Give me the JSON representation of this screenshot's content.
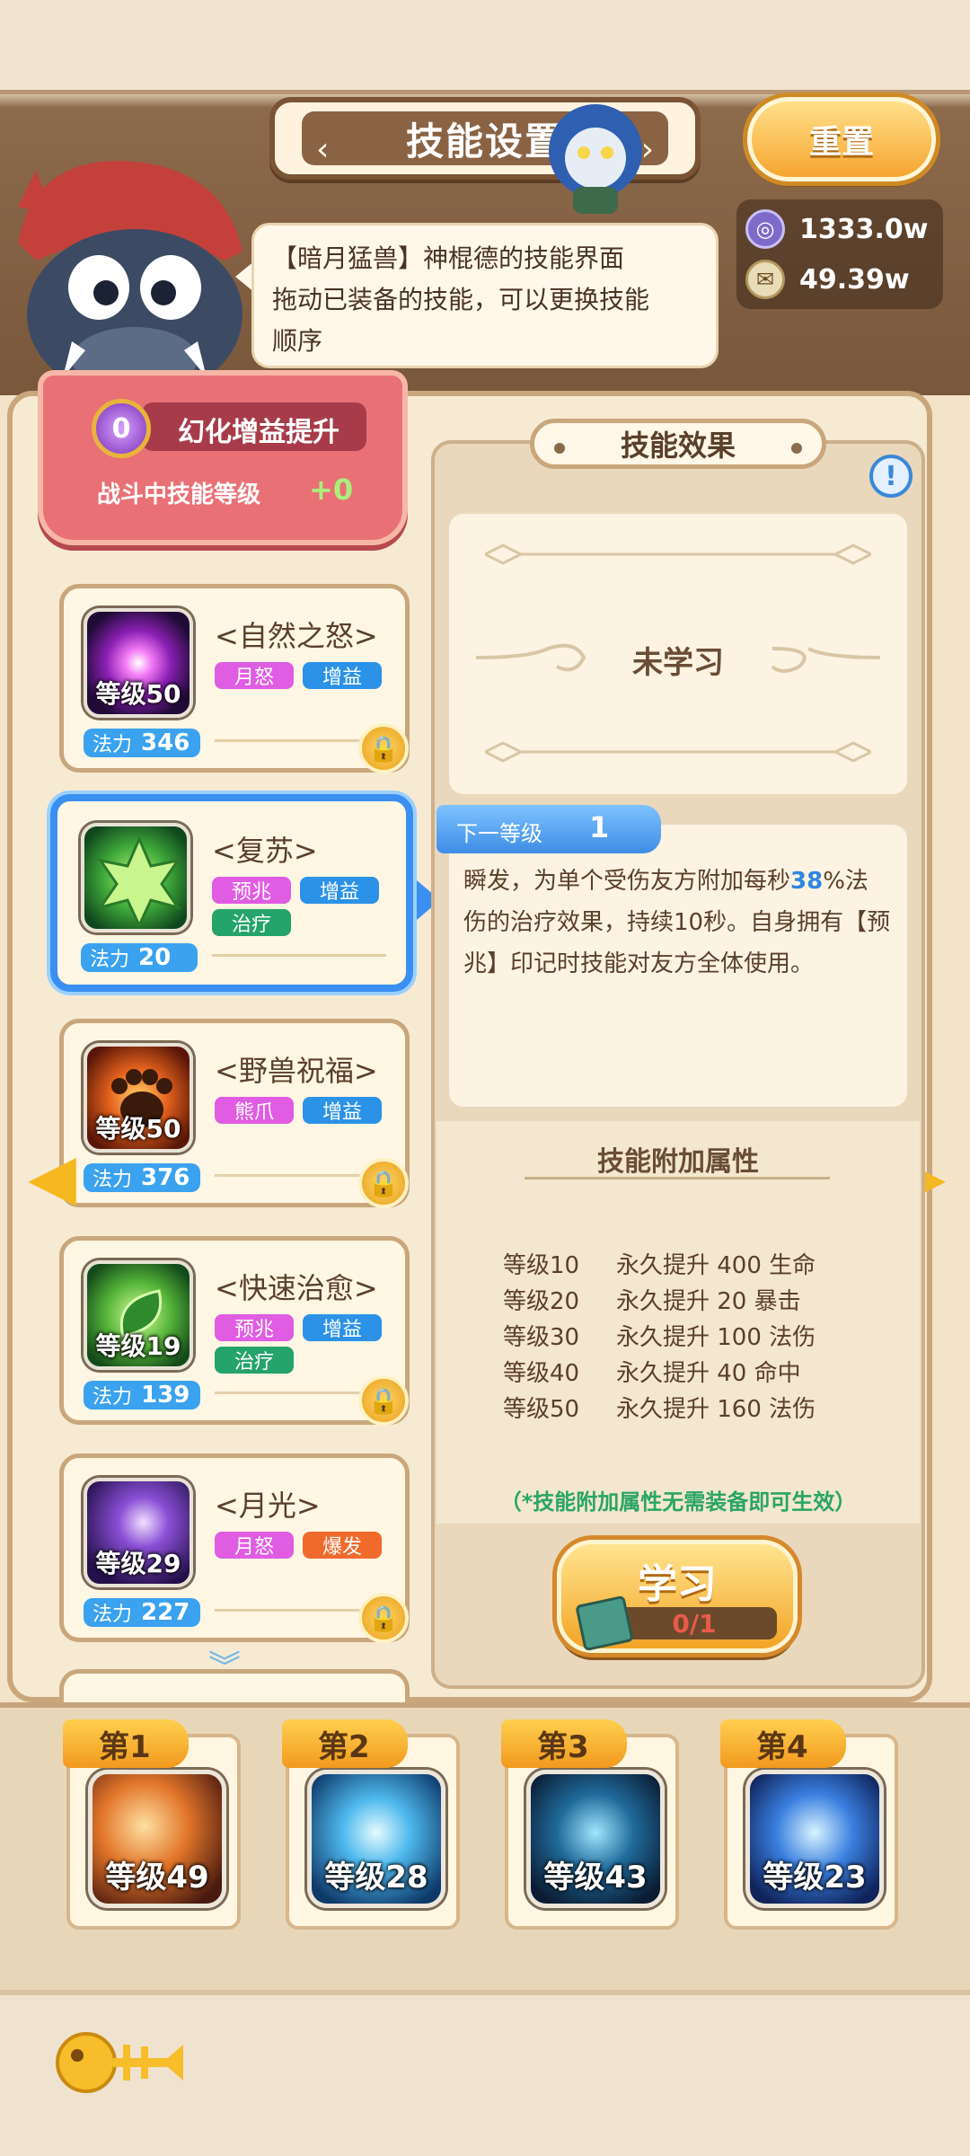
{
  "header": {
    "title": "技能设置",
    "reset_label": "重置"
  },
  "currency": [
    {
      "icon": "coin-icon",
      "value": "1333.0w"
    },
    {
      "icon": "scroll-icon",
      "value": "49.39w"
    }
  ],
  "speech": {
    "line1": "【暗月猛兽】神棍德的技能界面",
    "line2": "拖动已装备的技能，可以更换技能",
    "line3": "顺序"
  },
  "boost": {
    "badge": "0",
    "title": "幻化增益提升",
    "label": "战斗中技能等级",
    "value": "+0"
  },
  "skills": [
    {
      "name": "<自然之怒>",
      "level": "等级50",
      "tags": [
        "月怒",
        "增益"
      ],
      "mana_label": "法力",
      "mana": "346",
      "locked": true
    },
    {
      "name": "<复苏>",
      "level": "",
      "tags": [
        "预兆",
        "增益",
        "治疗"
      ],
      "mana_label": "法力",
      "mana": "20",
      "locked": false
    },
    {
      "name": "<野兽祝福>",
      "level": "等级50",
      "tags": [
        "熊爪",
        "增益"
      ],
      "mana_label": "法力",
      "mana": "376",
      "locked": true
    },
    {
      "name": "<快速治愈>",
      "level": "等级19",
      "tags": [
        "预兆",
        "增益",
        "治疗"
      ],
      "mana_label": "法力",
      "mana": "139",
      "locked": true
    },
    {
      "name": "<月光>",
      "level": "等级29",
      "tags": [
        "月怒",
        "爆发"
      ],
      "mana_label": "法力",
      "mana": "227",
      "locked": true
    }
  ],
  "effect": {
    "title": "技能效果",
    "status": "未学习",
    "next_level_label": "下一等级",
    "next_level_value": "1",
    "desc_part1": "瞬发，为单个受伤友方附加每秒",
    "desc_highlight": "38",
    "desc_part2": "%法伤的治疗效果，持续10秒。自身拥有【预兆】印记时技能对友方全体使用。",
    "attr_title": "技能附加属性",
    "attrs": [
      {
        "level": "等级10",
        "effect": "永久提升 400 生命"
      },
      {
        "level": "等级20",
        "effect": "永久提升 20 暴击"
      },
      {
        "level": "等级30",
        "effect": "永久提升 100 法伤"
      },
      {
        "level": "等级40",
        "effect": "永久提升 40 命中"
      },
      {
        "level": "等级50",
        "effect": "永久提升 160 法伤"
      }
    ],
    "note": "（*技能附加属性无需装备即可生效）",
    "learn_label": "学习",
    "learn_progress": "0/1"
  },
  "equipped": [
    {
      "slot": "第1",
      "level": "等级49"
    },
    {
      "slot": "第2",
      "level": "等级28"
    },
    {
      "slot": "第3",
      "level": "等级43"
    },
    {
      "slot": "第4",
      "level": "等级23"
    }
  ],
  "colors": {
    "accent_blue": "#3a8ff0",
    "tag_pink": "#e05ce3",
    "tag_blue": "#2b92e8",
    "tag_green": "#24a36a",
    "tag_orange": "#f06a2c",
    "note_green": "#2aa564"
  }
}
